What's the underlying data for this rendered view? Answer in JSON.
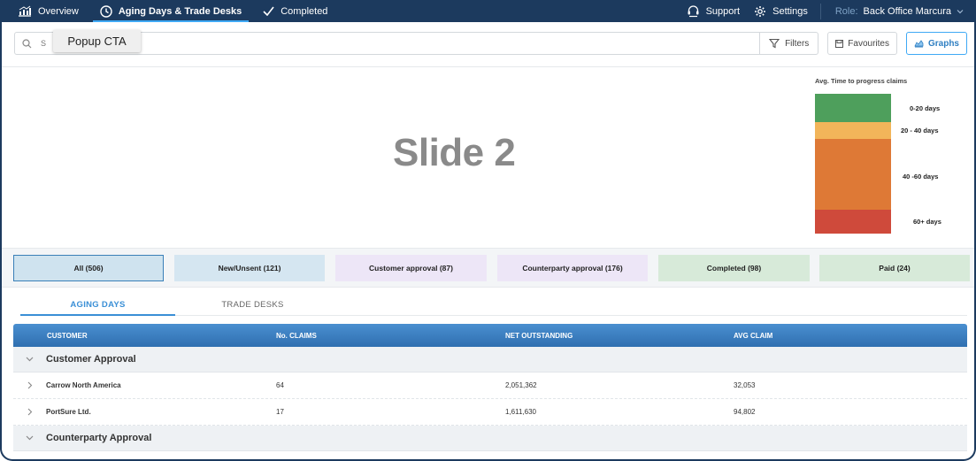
{
  "nav": {
    "tabs": [
      {
        "label": "Overview",
        "icon": "bar-chart-icon"
      },
      {
        "label": "Aging Days & Trade Desks",
        "icon": "clock-icon"
      },
      {
        "label": "Completed",
        "icon": "check-icon"
      }
    ],
    "support_label": "Support",
    "settings_label": "Settings",
    "role_label": "Role:",
    "role_value": "Back Office Marcura"
  },
  "search": {
    "placeholder": "S          , cp date etc...",
    "filters_label": "Filters"
  },
  "toolbar": {
    "favourites_label": "Favourites",
    "graphs_label": "Graphs"
  },
  "popup": {
    "label": "Popup CTA"
  },
  "slide": {
    "title": "Slide 2"
  },
  "legend": {
    "title": "Avg. Time to progress claims",
    "items": [
      {
        "label": "0-20 days",
        "color": "#4e9f5c"
      },
      {
        "label": "20 - 40 days",
        "color": "#f2b55a"
      },
      {
        "label": "40 -60 days",
        "color": "#de7936"
      },
      {
        "label": "60+ days",
        "color": "#cf4a3b"
      }
    ]
  },
  "status_tabs": [
    {
      "label": "All (506)",
      "color": "#cfe3ef"
    },
    {
      "label": "New/Unsent (121)",
      "color": "#d5e6f1"
    },
    {
      "label": "Customer approval (87)",
      "color": "#ede6f7"
    },
    {
      "label": "Counterparty approval (176)",
      "color": "#ede6f7"
    },
    {
      "label": "Completed (98)",
      "color": "#d7ead9"
    },
    {
      "label": "Paid (24)",
      "color": "#d7ead9"
    }
  ],
  "sub_tabs": [
    {
      "label": "AGING DAYS"
    },
    {
      "label": "TRADE DESKS"
    }
  ],
  "table": {
    "columns": [
      "CUSTOMER",
      "No. CLAIMS",
      "NET OUTSTANDING",
      "AVG CLAIM"
    ],
    "groups": [
      {
        "name": "Customer Approval",
        "rows": [
          {
            "customer": "Carrow North America",
            "claims": "64",
            "net": "2,051,362",
            "avg": "32,053"
          },
          {
            "customer": "PortSure Ltd.",
            "claims": "17",
            "net": "1,611,630",
            "avg": "94,802"
          }
        ]
      },
      {
        "name": "Counterparty Approval",
        "rows": []
      }
    ]
  }
}
